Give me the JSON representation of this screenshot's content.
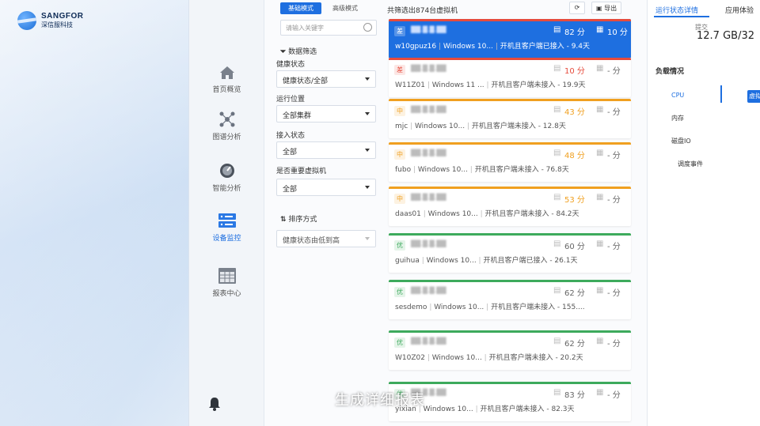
{
  "brand": {
    "name": "SANGFOR",
    "subname": "深信服科技"
  },
  "nav": {
    "items": [
      {
        "label": "首页概览",
        "icon": "home-icon"
      },
      {
        "label": "图谱分析",
        "icon": "graph-icon"
      },
      {
        "label": "智能分析",
        "icon": "gauge-icon"
      },
      {
        "label": "设备监控",
        "icon": "monitor-icon"
      },
      {
        "label": "报表中心",
        "icon": "report-icon"
      }
    ],
    "active": "设备监控"
  },
  "filter": {
    "tabs": [
      "基础模式",
      "高级模式"
    ],
    "active_tab": "基础模式",
    "search_placeholder": "请输入关键字",
    "section_title": "数据筛选",
    "fields": [
      {
        "label": "健康状态",
        "value": "健康状态/全部"
      },
      {
        "label": "运行位置",
        "value": "全部集群"
      },
      {
        "label": "接入状态",
        "value": "全部"
      },
      {
        "label": "是否重要虚拟机",
        "value": "全部"
      }
    ],
    "sort_title": "排序方式",
    "sort_value": "健康状态由低到高"
  },
  "list": {
    "header": "共筛选出874台虚拟机",
    "refresh_label": "⟳",
    "export_label": "导出",
    "cards": [
      {
        "tag": "差",
        "score": "82 分",
        "metric": "10 分",
        "name": "w10gpuz16",
        "os": "Windows 10...",
        "status": "开机且客户端已接入 - 9.4天",
        "color": "#e64b3c"
      },
      {
        "tag": "差",
        "score": "10 分",
        "metric": "- 分",
        "name": "W11Z01",
        "os": "Windows 11 ...",
        "status": "开机且客户端未接入 - 19.9天",
        "color": "#e64b3c"
      },
      {
        "tag": "中",
        "score": "43 分",
        "metric": "- 分",
        "name": "mjc",
        "os": "Windows 10...",
        "status": "开机且客户端未接入 - 12.8天",
        "color": "#f0a020"
      },
      {
        "tag": "中",
        "score": "48 分",
        "metric": "- 分",
        "name": "fubo",
        "os": "Windows 10...",
        "status": "开机且客户端未接入 - 76.8天",
        "color": "#f0a020"
      },
      {
        "tag": "中",
        "score": "53 分",
        "metric": "- 分",
        "name": "daas01",
        "os": "Windows 10...",
        "status": "开机且客户端未接入 - 84.2天",
        "color": "#f0a020"
      },
      {
        "tag": "优",
        "score": "60 分",
        "metric": "- 分",
        "name": "guihua",
        "os": "Windows 10...",
        "status": "开机且客户端已接入 - 26.1天",
        "color": "#3daa5c"
      },
      {
        "tag": "优",
        "score": "62 分",
        "metric": "- 分",
        "name": "sesdemo",
        "os": "Windows 10...",
        "status": "开机且客户端未接入 - 155....",
        "color": "#3daa5c"
      },
      {
        "tag": "优",
        "score": "62 分",
        "metric": "- 分",
        "name": "W10Z02",
        "os": "Windows 10...",
        "status": "开机且客户端未接入 - 20.2天",
        "color": "#3daa5c"
      },
      {
        "tag": "优",
        "score": "83 分",
        "metric": "- 分",
        "name": "yixian",
        "os": "Windows 10...",
        "status": "开机且客户端未接入 - 82.3天",
        "color": "#3daa5c"
      }
    ]
  },
  "detail": {
    "tabs": [
      "运行状态详情",
      "应用体验"
    ],
    "cap_label": "提交",
    "cap_value": "12.7 GB/32",
    "load_title": "负载情况",
    "load_items": [
      "CPU",
      "内存",
      "磁盘IO",
      "调度事件"
    ],
    "load_button": "虚拟"
  },
  "subtitle": "生成详细报表"
}
